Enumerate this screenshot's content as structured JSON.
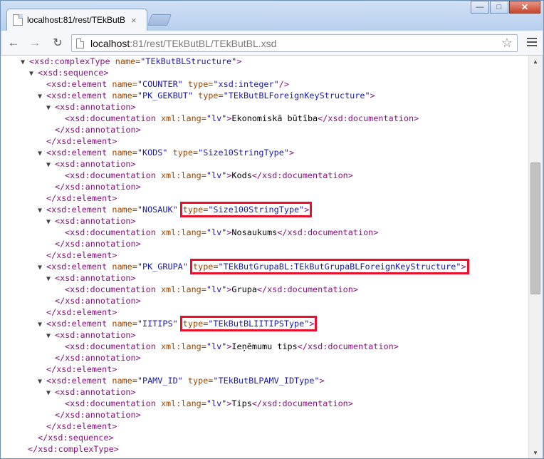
{
  "browser": {
    "tab_title": "localhost:81/rest/TEkButBL/T",
    "tab_close": "×",
    "url_host": "localhost",
    "url_path": ":81/rest/TEkButBL/TEkButBL.xsd",
    "window_buttons": {
      "minimize": "—",
      "maximize": "□",
      "close": "✕"
    },
    "nav": {
      "back": "←",
      "forward": "→",
      "reload": "↻",
      "star": "☆"
    }
  },
  "xml": {
    "complexType_open": {
      "tri": "▼",
      "tag_open": "<xsd:complexType ",
      "attr": "name=",
      "value": "\"TEkButBLStructure\"",
      "tag_close": ">"
    },
    "sequence_open": {
      "tri": "▼",
      "tag": "<xsd:sequence>"
    },
    "elements": [
      {
        "tri": "",
        "tag_open": "<xsd:element ",
        "name_attr": "name=",
        "name_val": "\"COUNTER\"",
        "type_attr": "type=",
        "type_val": "\"xsd:integer\"",
        "tag_close": "/>"
      },
      {
        "tri": "▼",
        "tag_open": "<xsd:element ",
        "name_attr": "name=",
        "name_val": "\"PK_GEKBUT\"",
        "type_attr": "type=",
        "type_val": "\"TEkButBLForeignKeyStructure\"",
        "tag_close": ">",
        "doc": "Ekonomiskā būtība"
      },
      {
        "tri": "▼",
        "tag_open": "<xsd:element ",
        "name_attr": "name=",
        "name_val": "\"KODS\"",
        "type_attr": "type=",
        "type_val": "\"Size10StringType\"",
        "tag_close": ">",
        "doc": "Kods"
      },
      {
        "tri": "▼",
        "tag_open": "<xsd:element ",
        "name_attr": "name=",
        "name_val": "\"NOSAUK\"",
        "type_attr": "type=",
        "type_val": "\"Size100StringType\"",
        "tag_close": ">",
        "doc": "Nosaukums",
        "highlight": true
      },
      {
        "tri": "▼",
        "tag_open": "<xsd:element ",
        "name_attr": "name=",
        "name_val": "\"PK_GRUPA\"",
        "type_attr": "type=",
        "type_val": "\"TEkButGrupaBL:TEkButGrupaBLForeignKeyStructure\"",
        "tag_close": ">",
        "doc": "Grupa",
        "highlight": true
      },
      {
        "tri": "▼",
        "tag_open": "<xsd:element ",
        "name_attr": "name=",
        "name_val": "\"IITIPS\"",
        "type_attr": "type=",
        "type_val": "\"TEkButBLIITIPSType\"",
        "tag_close": ">",
        "doc": "Ieņēmumu tips",
        "highlight": true
      },
      {
        "tri": "▼",
        "tag_open": "<xsd:element ",
        "name_attr": "name=",
        "name_val": "\"PAMV_ID\"",
        "type_attr": "type=",
        "type_val": "\"TEkButBLPAMV_IDType\"",
        "tag_close": ">",
        "doc": "Tips"
      }
    ],
    "annotation_open": {
      "tri": "▼",
      "tag": "<xsd:annotation>"
    },
    "documentation": {
      "tag_open": "<xsd:documentation ",
      "attr": "xml:lang=",
      "value": "\"lv\"",
      "gt": ">",
      "tag_close": "</xsd:documentation>"
    },
    "annotation_close": "</xsd:annotation>",
    "element_close": "</xsd:element>",
    "sequence_close": "</xsd:sequence>",
    "complexType_close": "</xsd:complexType>"
  }
}
